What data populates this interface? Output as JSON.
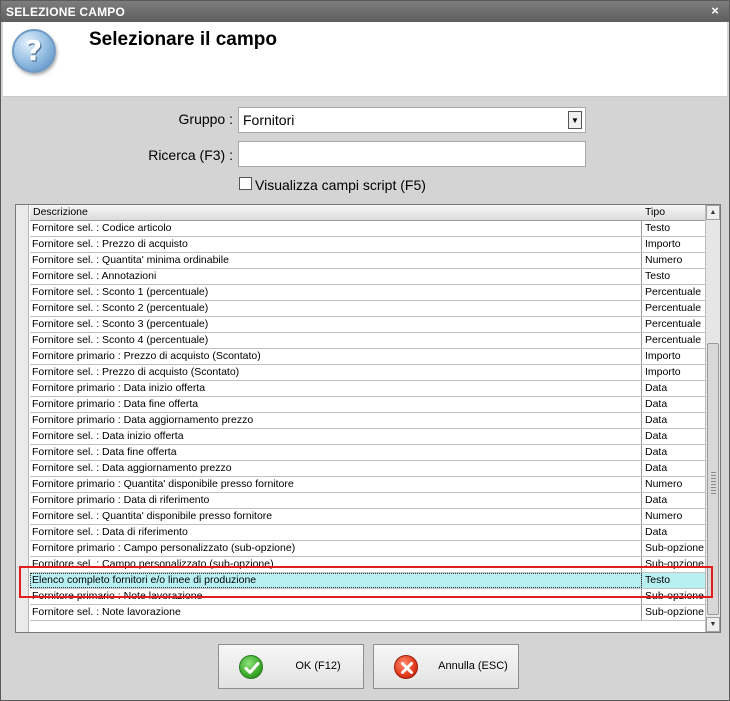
{
  "window": {
    "title": "SELEZIONE CAMPO",
    "close_glyph": "×"
  },
  "header": {
    "title": "Selezionare il campo",
    "icon": "question-icon"
  },
  "form": {
    "group_label": "Gruppo :",
    "group_value": "Fornitori",
    "search_label": "Ricerca (F3) :",
    "search_value": "",
    "search_placeholder": "",
    "script_checkbox_label": "Visualizza campi script (F5)",
    "script_checked": false
  },
  "grid": {
    "columns": [
      "Descrizione",
      "Tipo"
    ],
    "selected_index": 22,
    "rows": [
      [
        "Fornitore sel. : Codice articolo",
        "Testo"
      ],
      [
        "Fornitore sel. : Prezzo di acquisto",
        "Importo"
      ],
      [
        "Fornitore sel. : Quantita' minima ordinabile",
        "Numero"
      ],
      [
        "Fornitore sel. : Annotazioni",
        "Testo"
      ],
      [
        "Fornitore sel. : Sconto 1 (percentuale)",
        "Percentuale"
      ],
      [
        "Fornitore sel. : Sconto 2 (percentuale)",
        "Percentuale"
      ],
      [
        "Fornitore sel. : Sconto 3 (percentuale)",
        "Percentuale"
      ],
      [
        "Fornitore sel. : Sconto 4 (percentuale)",
        "Percentuale"
      ],
      [
        "Fornitore primario : Prezzo di acquisto (Scontato)",
        "Importo"
      ],
      [
        "Fornitore sel. : Prezzo di acquisto (Scontato)",
        "Importo"
      ],
      [
        "Fornitore primario : Data inizio offerta",
        "Data"
      ],
      [
        "Fornitore primario : Data fine offerta",
        "Data"
      ],
      [
        "Fornitore primario : Data aggiornamento prezzo",
        "Data"
      ],
      [
        "Fornitore sel. : Data inizio offerta",
        "Data"
      ],
      [
        "Fornitore sel. : Data fine offerta",
        "Data"
      ],
      [
        "Fornitore sel. : Data aggiornamento prezzo",
        "Data"
      ],
      [
        "Fornitore primario : Quantita' disponibile presso fornitore",
        "Numero"
      ],
      [
        "Fornitore primario : Data di riferimento",
        "Data"
      ],
      [
        "Fornitore sel. : Quantita' disponibile presso fornitore",
        "Numero"
      ],
      [
        "Fornitore sel. : Data di riferimento",
        "Data"
      ],
      [
        "Fornitore primario : Campo personalizzato (sub-opzione)",
        "Sub-opzione"
      ],
      [
        "Fornitore sel. : Campo personalizzato (sub-opzione)",
        "Sub-opzione"
      ],
      [
        "Elenco completo fornitori e/o linee di produzione",
        "Testo"
      ],
      [
        "Fornitore primario : Note lavorazione",
        "Sub-opzione"
      ],
      [
        "Fornitore sel. : Note lavorazione",
        "Sub-opzione"
      ]
    ]
  },
  "buttons": {
    "ok_label": "OK (F12)",
    "cancel_label": "Annulla (ESC)"
  },
  "colors": {
    "selected_row": "#b8f0f2",
    "highlight_border": "#e01e1e",
    "titlebar": "#6a6a6a"
  }
}
